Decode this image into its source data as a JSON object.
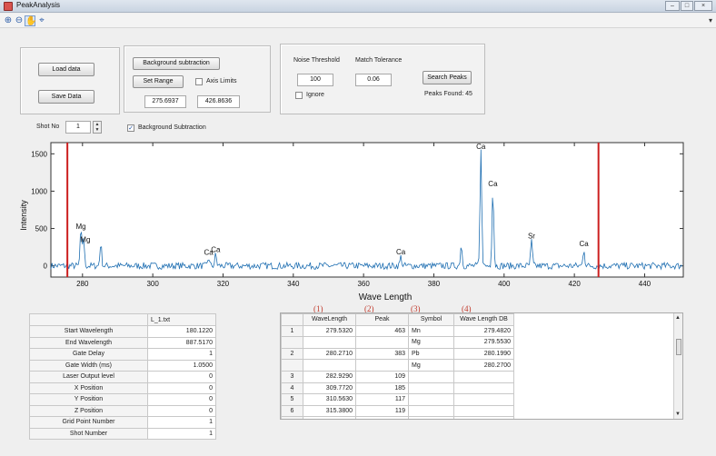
{
  "window": {
    "title": "PeakAnalysis",
    "buttons": [
      "–",
      "□",
      "×"
    ]
  },
  "toolbar": {
    "tools": [
      {
        "name": "zoom-in-icon",
        "glyph": "⊕"
      },
      {
        "name": "zoom-out-icon",
        "glyph": "⊖"
      },
      {
        "name": "pan-icon",
        "glyph": "✋"
      },
      {
        "name": "data-cursor-icon",
        "glyph": "⌖"
      }
    ],
    "overflow_glyph": "▾"
  },
  "controls": {
    "load_label": "Load data",
    "save_label": "Save Data",
    "bg_sub_label": "Background subtraction",
    "set_range_label": "Set Range",
    "axis_limits_label": "Axis Limits",
    "range_min": "275.6937",
    "range_max": "426.8636",
    "noise_threshold_label": "Noise Threshold",
    "noise_threshold_value": "100",
    "match_tolerance_label": "Match Tolerance",
    "match_tolerance_value": "0.06",
    "ignore_label": "Ignore",
    "search_label": "Search Peaks",
    "peaks_found": "Peaks Found: 45",
    "shot_no_label": "Shot No",
    "shot_no_value": "1",
    "bg_sub_checkbox_label": "Background Subtraction",
    "bg_sub_checked": true,
    "axis_limits_checked": false,
    "ignore_checked": false
  },
  "chart_data": {
    "type": "line",
    "xlabel": "Wave Length",
    "ylabel": "Intensity",
    "xlim": [
      271,
      451
    ],
    "ylim": [
      -150,
      1650
    ],
    "xticks": [
      280,
      300,
      320,
      340,
      360,
      380,
      400,
      420,
      440
    ],
    "yticks": [
      0,
      500,
      1000,
      1500
    ],
    "range_lines": [
      275.6937,
      426.8636
    ],
    "range_line_color": "#cc1f1f",
    "line_color": "#1f6fb2",
    "baseline": 0,
    "noise_amplitude": 45,
    "peaks": [
      {
        "x": 279.55,
        "y": 460,
        "label": "Mg"
      },
      {
        "x": 280.27,
        "y": 380,
        "label": "Mg"
      },
      {
        "x": 285.2,
        "y": 300,
        "label": ""
      },
      {
        "x": 315.9,
        "y": 110,
        "label": "Ca"
      },
      {
        "x": 317.9,
        "y": 150,
        "label": "Ca"
      },
      {
        "x": 370.6,
        "y": 120,
        "label": "Ca"
      },
      {
        "x": 387.8,
        "y": 280,
        "label": ""
      },
      {
        "x": 393.4,
        "y": 1530,
        "label": "Ca"
      },
      {
        "x": 396.8,
        "y": 1030,
        "label": "Ca"
      },
      {
        "x": 407.8,
        "y": 330,
        "label": "Sr"
      },
      {
        "x": 422.7,
        "y": 230,
        "label": "Ca"
      }
    ]
  },
  "properties_table": {
    "header": "L_1.txt",
    "rows": [
      {
        "name": "Start Wavelength",
        "value": "180.1220"
      },
      {
        "name": "End Wavelength",
        "value": "887.5170"
      },
      {
        "name": "Gate Delay",
        "value": "1"
      },
      {
        "name": "Gate Width (ms)",
        "value": "1.0500"
      },
      {
        "name": "Laser Output level",
        "value": "0"
      },
      {
        "name": "X Position",
        "value": "0"
      },
      {
        "name": "Y Position",
        "value": "0"
      },
      {
        "name": "Z Position",
        "value": "0"
      },
      {
        "name": "Grid Point Number",
        "value": "1"
      },
      {
        "name": "Shot Number",
        "value": "1"
      }
    ]
  },
  "results_table": {
    "column_numbers": [
      "(1)",
      "(2)",
      "(3)",
      "(4)"
    ],
    "headers": [
      "WaveLength",
      "Peak",
      "Symbol",
      "Wave Length DB"
    ],
    "rows": [
      {
        "n": "1",
        "wl": "279.5320",
        "peak": "463",
        "sym": "Mn",
        "db": "279.4820"
      },
      {
        "n": "",
        "wl": "",
        "peak": "",
        "sym": "Mg",
        "db": "279.5530"
      },
      {
        "n": "2",
        "wl": "280.2710",
        "peak": "383",
        "sym": "Pb",
        "db": "280.1990"
      },
      {
        "n": "",
        "wl": "",
        "peak": "",
        "sym": "Mg",
        "db": "280.2700"
      },
      {
        "n": "3",
        "wl": "282.9290",
        "peak": "109",
        "sym": "",
        "db": ""
      },
      {
        "n": "4",
        "wl": "309.7720",
        "peak": "185",
        "sym": "",
        "db": ""
      },
      {
        "n": "5",
        "wl": "310.5630",
        "peak": "117",
        "sym": "",
        "db": ""
      },
      {
        "n": "6",
        "wl": "315.3800",
        "peak": "119",
        "sym": "",
        "db": ""
      },
      {
        "n": "7",
        "wl": "315.9040",
        "peak": "109",
        "sym": "Ca",
        "db": "315.8870"
      },
      {
        "n": "8",
        "wl": "316.6020",
        "peak": "159",
        "sym": "",
        "db": ""
      }
    ]
  }
}
